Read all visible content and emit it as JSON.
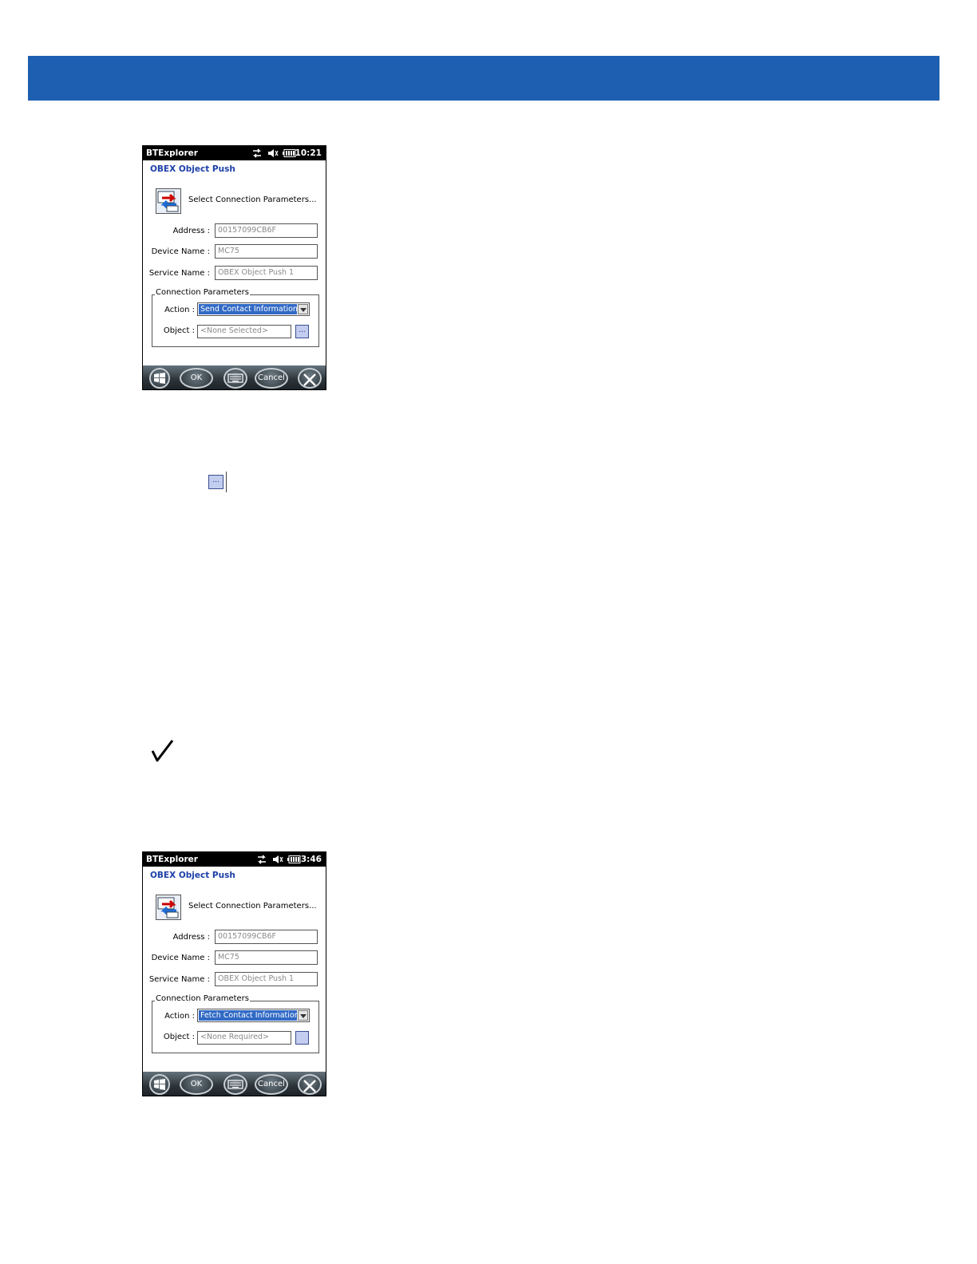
{
  "colors": {
    "header_band": "#1f5fb1",
    "title_blue": "#1c3fa8",
    "selection": "#316ac5"
  },
  "screens": [
    {
      "status": {
        "app_title": "BTExplorer",
        "clock": "10:21",
        "icons": [
          "sync-icon",
          "speaker-muted-icon",
          "battery-icon"
        ]
      },
      "title": "OBEX Object Push",
      "wizard_text": "Select Connection Parameters...",
      "fields": {
        "address_label": "Address :",
        "address_value": "00157099CB6F",
        "device_label": "Device Name :",
        "device_value": "MC75",
        "service_label": "Service Name :",
        "service_value": "OBEX Object Push 1"
      },
      "group_title": "Connection Parameters",
      "action_label": "Action :",
      "action_value": "Send Contact Information",
      "object_label": "Object :",
      "object_value": "<None Selected>",
      "browse_label": "...",
      "softkeys": {
        "ok": "OK",
        "cancel": "Cancel",
        "icons": [
          "windows-start-icon",
          "keyboard-icon",
          "close-icon"
        ]
      }
    },
    {
      "status": {
        "app_title": "BTExplorer",
        "clock": "3:46",
        "icons": [
          "sync-icon",
          "speaker-muted-icon",
          "battery-icon"
        ]
      },
      "title": "OBEX Object Push",
      "wizard_text": "Select Connection Parameters...",
      "fields": {
        "address_label": "Address :",
        "address_value": "00157099CB6F",
        "device_label": "Device Name :",
        "device_value": "MC75",
        "service_label": "Service Name :",
        "service_value": "OBEX Object Push 1"
      },
      "group_title": "Connection Parameters",
      "action_label": "Action :",
      "action_value": "Fetch Contact Information",
      "object_label": "Object :",
      "object_value": "<None Required>",
      "browse_label": "",
      "softkeys": {
        "ok": "OK",
        "cancel": "Cancel",
        "icons": [
          "windows-start-icon",
          "keyboard-icon",
          "close-icon"
        ]
      }
    }
  ],
  "inline_button": {
    "label": "..."
  },
  "note_icon": "checkmark-icon"
}
